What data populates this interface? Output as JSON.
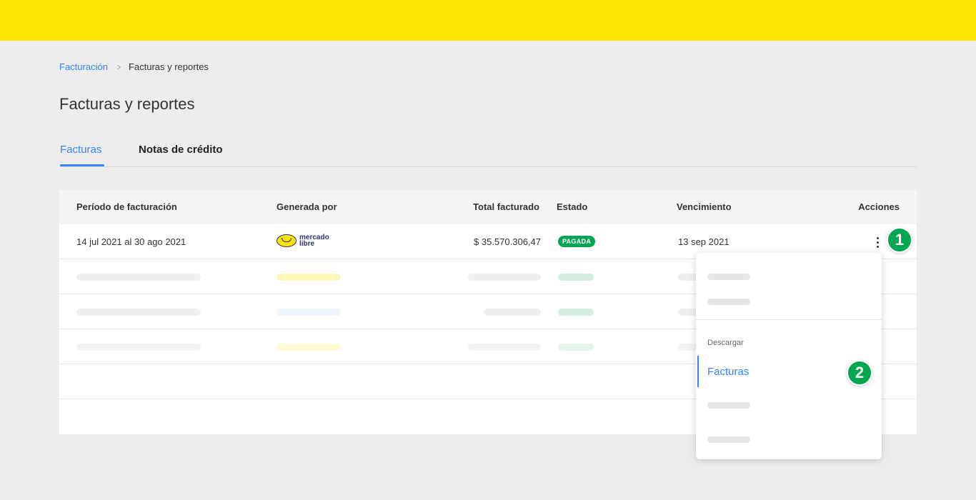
{
  "colors": {
    "brand_yellow": "#ffe600",
    "accent_blue": "#3483fa",
    "status_green": "#00a650"
  },
  "breadcrumb": {
    "parent": "Facturación",
    "separator_icon": "chevron-right-icon",
    "current": "Facturas y reportes"
  },
  "page_title": "Facturas y reportes",
  "tabs": [
    {
      "label": "Facturas",
      "active": true
    },
    {
      "label": "Notas de crédito",
      "active": false
    }
  ],
  "table": {
    "columns": [
      "Período de facturación",
      "Generada por",
      "Total facturado",
      "Estado",
      "Vencimiento",
      "Acciones"
    ],
    "rows": [
      {
        "period": "14 jul 2021 al 30 ago 2021",
        "generated_by": {
          "logo": "mercado-libre-logo",
          "text_line1": "mercado",
          "text_line2": "libre"
        },
        "total": "$ 35.570.306,47",
        "status": "PAGADA",
        "due": "13 sep 2021",
        "actions_icon": "kebab-menu-icon"
      }
    ],
    "placeholder_rows": 5
  },
  "step_markers": [
    "1",
    "2"
  ],
  "actions_menu": {
    "section_label": "Descargar",
    "active_item": "Facturas"
  }
}
